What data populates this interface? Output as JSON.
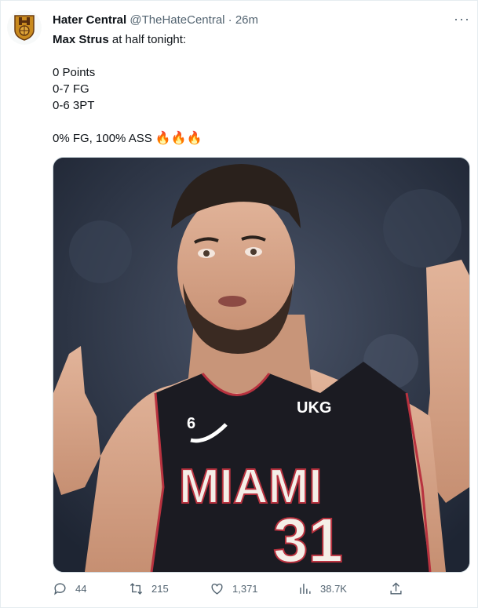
{
  "tweet": {
    "author_name": "Hater Central",
    "handle": "@TheHateCentral",
    "separator": "·",
    "time": "26m",
    "more_label": "···",
    "text": {
      "line1_bold": "Max Strus",
      "line1_rest": " at half tonight:",
      "stat1": "0 Points",
      "stat2": "0-7 FG",
      "stat3": "0-6 3PT",
      "summary": "0% FG, 100% ASS ",
      "emojis": "🔥🔥🔥"
    },
    "media": {
      "jersey_team": "MIAMI",
      "jersey_number": "31",
      "patch_number": "6",
      "sponsor": "UKG"
    },
    "actions": {
      "replies": "44",
      "retweets": "215",
      "likes": "1,371",
      "views": "38.7K"
    }
  },
  "colors": {
    "accent": "#1d9bf0",
    "muted": "#536471",
    "text": "#0f1419",
    "jersey": "#1b1b22",
    "jersey_trim": "#b8323f"
  },
  "icons": [
    "team-logo-icon",
    "more-icon",
    "reply-icon",
    "retweet-icon",
    "like-icon",
    "views-icon",
    "share-icon"
  ]
}
